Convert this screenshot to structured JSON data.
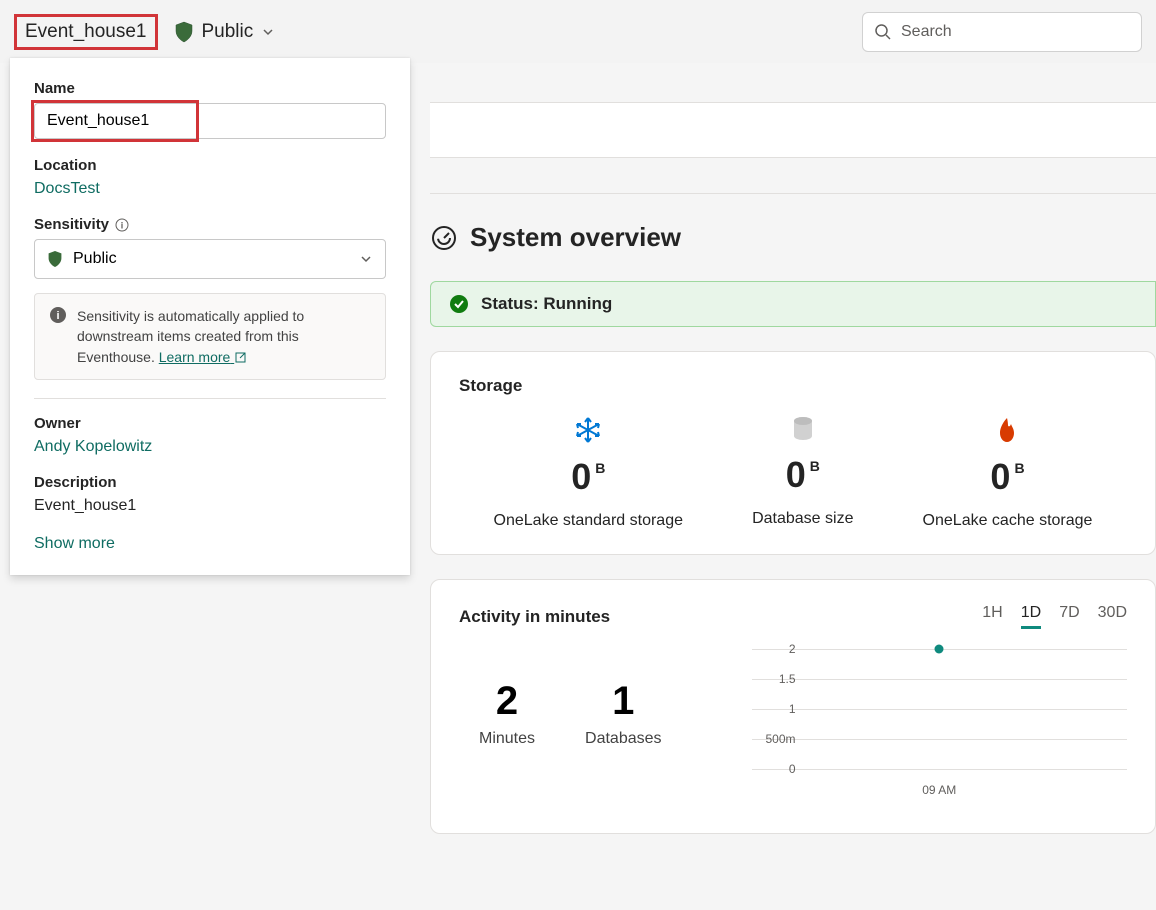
{
  "topbar": {
    "title": "Event_house1",
    "visibility": "Public",
    "search_placeholder": "Search"
  },
  "popover": {
    "name_label": "Name",
    "name_value": "Event_house1",
    "location_label": "Location",
    "location_value": "DocsTest",
    "sensitivity_label": "Sensitivity",
    "sensitivity_value": "Public",
    "info_text": "Sensitivity is automatically applied to downstream items created from this Eventhouse. ",
    "learn_more": "Learn more",
    "owner_label": "Owner",
    "owner_value": "Andy Kopelowitz",
    "description_label": "Description",
    "description_value": "Event_house1",
    "show_more": "Show more"
  },
  "overview": {
    "title": "System overview",
    "status_label": "Status: Running"
  },
  "storage": {
    "title": "Storage",
    "items": [
      {
        "value": "0",
        "unit": "B",
        "label": "OneLake standard storage",
        "icon": "snowflake"
      },
      {
        "value": "0",
        "unit": "B",
        "label": "Database size",
        "icon": "database"
      },
      {
        "value": "0",
        "unit": "B",
        "label": "OneLake cache storage",
        "icon": "flame"
      }
    ]
  },
  "activity": {
    "title": "Activity in minutes",
    "ranges": [
      "1H",
      "1D",
      "7D",
      "30D"
    ],
    "active_range": "1D",
    "stats": [
      {
        "value": "2",
        "label": "Minutes"
      },
      {
        "value": "1",
        "label": "Databases"
      }
    ]
  },
  "chart_data": {
    "type": "line",
    "title": "Activity in minutes",
    "xlabel": "",
    "ylabel": "",
    "ylim": [
      0,
      2
    ],
    "y_ticks": [
      "2",
      "1.5",
      "1",
      "500m",
      "0"
    ],
    "x_ticks": [
      "09 AM"
    ],
    "series": [
      {
        "name": "activity",
        "x": [
          "09 AM"
        ],
        "values": [
          2
        ]
      }
    ]
  }
}
